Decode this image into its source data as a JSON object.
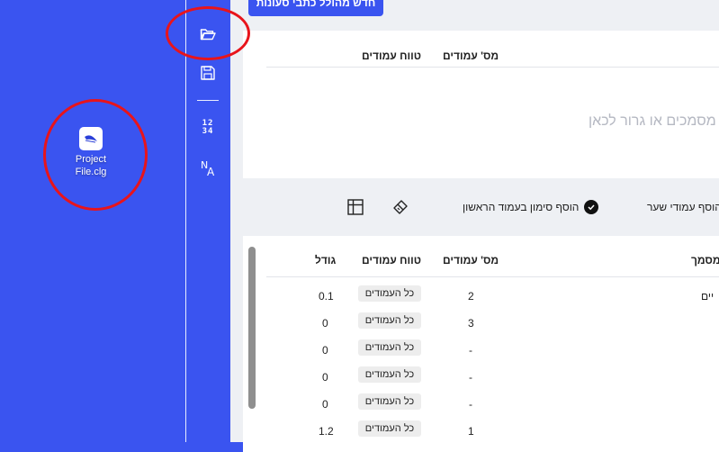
{
  "desktop": {
    "file_icon": {
      "label_line1": "Project",
      "label_line2": "File.clg"
    }
  },
  "toolbar": {
    "numbers_line1": "12",
    "numbers_line2": "34",
    "na_n": "N",
    "na_a": "A"
  },
  "main": {
    "top_button_label": "חדש מהולל כתבי סעונות",
    "upload_panel": {
      "col_pages": "מס' עמודים",
      "col_range": "טווח עמודים",
      "drop_text": "מסמכים או גרור לכאן"
    },
    "options": {
      "cover_pages": "הוסף עמודי שער",
      "first_column_mark": "הוסף סימון בעמוד הראשון"
    },
    "files_table": {
      "headers": {
        "document": "מסמך",
        "pages": "מס' עמודים",
        "range": "טווח עמודים",
        "size": "גודל"
      },
      "rows": [
        {
          "doc": "יים",
          "pages": "2",
          "range": "כל העמודים",
          "size": "0.1"
        },
        {
          "doc": "",
          "pages": "3",
          "range": "כל העמודים",
          "size": "0"
        },
        {
          "doc": "",
          "pages": "-",
          "range": "כל העמודים",
          "size": "0"
        },
        {
          "doc": "",
          "pages": "-",
          "range": "כל העמודים",
          "size": "0"
        },
        {
          "doc": "",
          "pages": "-",
          "range": "כל העמודים",
          "size": "0"
        },
        {
          "doc": "",
          "pages": "1",
          "range": "כל העמודים",
          "size": "1.2"
        }
      ]
    }
  },
  "colors": {
    "accent": "#3a54f0",
    "annotation": "#e8141b"
  }
}
